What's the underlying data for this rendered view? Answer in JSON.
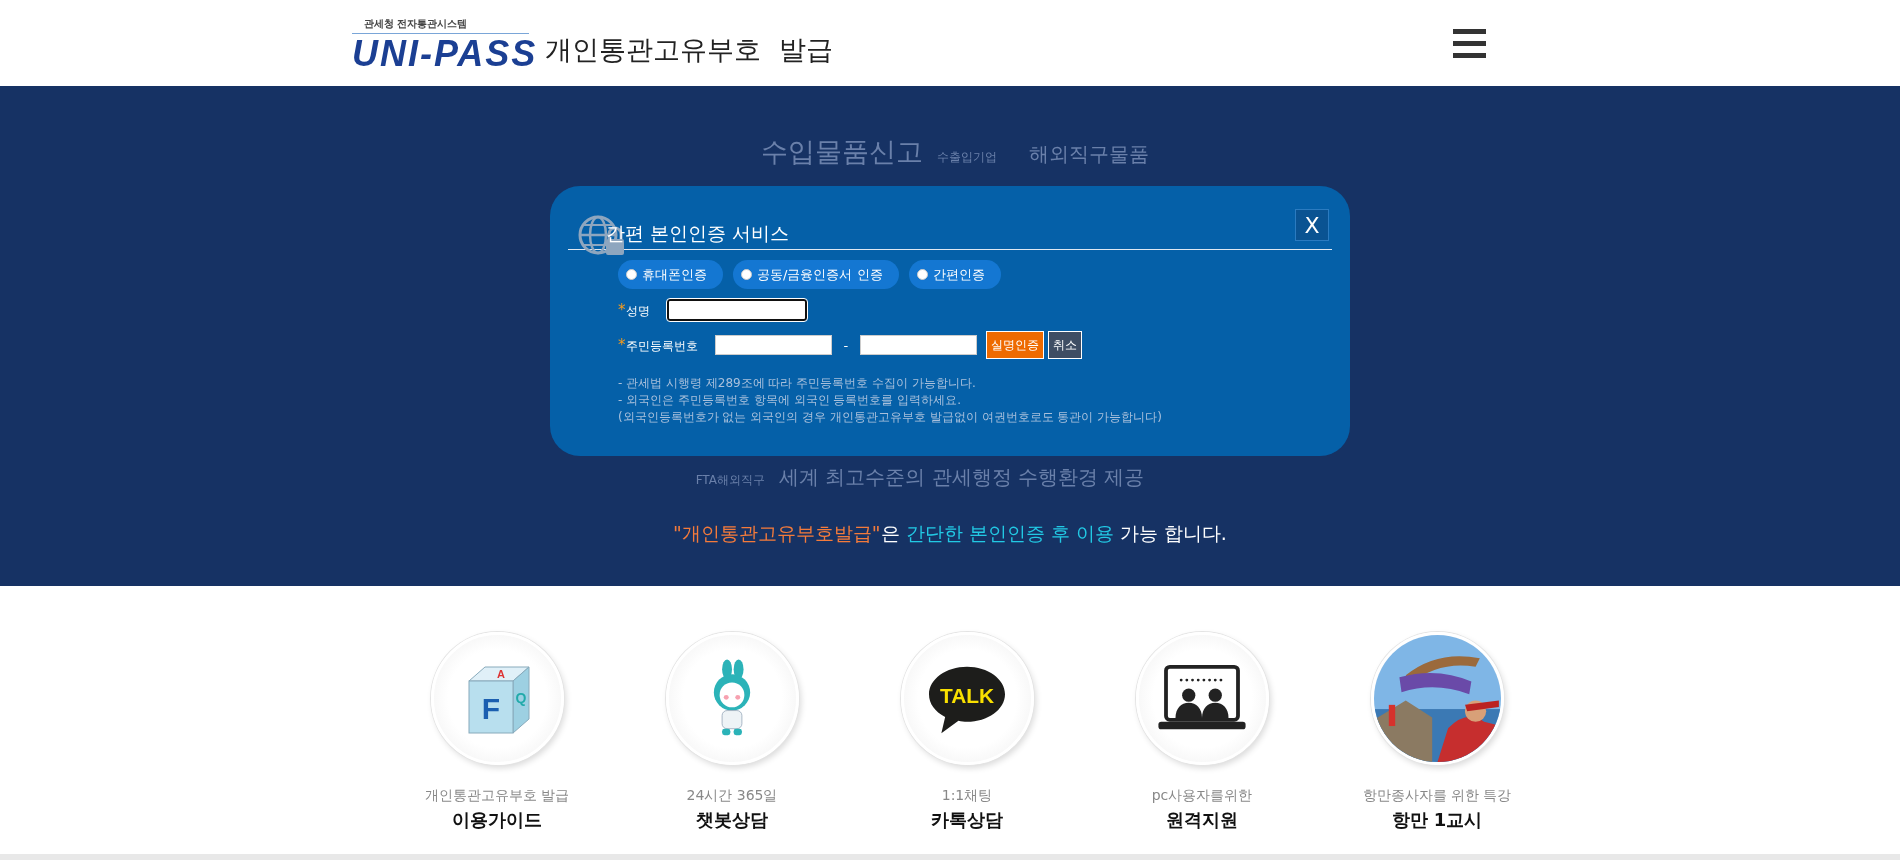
{
  "header": {
    "logo": {
      "caption": "관세청  전자통관시스템",
      "wordmark": "UNI-PASS"
    },
    "title": "개인통관고유부호  발급"
  },
  "background_words": {
    "row_1": [
      {
        "text": "수입물품신고",
        "prominent": true
      },
      {
        "text": "수출입기업",
        "prominent": false
      },
      {
        "text": "해외직구물품",
        "prominent": true
      }
    ],
    "row_2": [
      {
        "text": "FTA해외직구",
        "prominent": false
      },
      {
        "text": "세계 최고수준의 관세행정 수행환경 제공",
        "prominent": true
      }
    ]
  },
  "dialog": {
    "title": "간편 본인인증 서비스",
    "close": "X",
    "methods": [
      {
        "label": "휴대폰인증",
        "selected": false
      },
      {
        "label": "공동/금융인증서 인증",
        "selected": false
      },
      {
        "label": "간편인증",
        "selected": false
      }
    ],
    "name_field": {
      "required_mark": "*",
      "label": "성명",
      "focused": true
    },
    "id_field": {
      "required_mark": "*",
      "label": "주민등록번호",
      "separator": "-"
    },
    "buttons": [
      {
        "label": "실명인증",
        "kind": "primary"
      },
      {
        "label": "취소",
        "kind": "secondary"
      }
    ],
    "notes": [
      "- 관세법 시행령 제289조에 따라 주민등록번호 수집이 가능합니다.",
      "- 외국인은 주민등록번호 항목에 외국인 등록번호를 입력하세요.",
      "(외국인등록번호가 없는 외국인의 경우 개인통관고유부호 발급없이 여권번호로도 통관이 가능합니다)"
    ]
  },
  "message": [
    {
      "text": "\"개인통관고유부호발급\"",
      "color": "#f47b3b"
    },
    {
      "text": "은 ",
      "color": "#ffffff"
    },
    {
      "text": "간단한 본인인증 후 이용",
      "color": "#22c9e4"
    },
    {
      "text": " 가능 합니다.",
      "color": "#ffffff"
    }
  ],
  "services": [
    {
      "kind": "faq",
      "icon_letters": [
        "A",
        "F",
        "Q"
      ],
      "subtitle": "개인통관고유부호 발급",
      "title": "이용가이드"
    },
    {
      "kind": "chatbot",
      "subtitle": "24시간 365일",
      "title": "챗봇상담"
    },
    {
      "kind": "talk",
      "icon_text": "TALK",
      "subtitle": "1:1채팅",
      "title": "카톡상담"
    },
    {
      "kind": "remote",
      "subtitle": "pc사용자를위한",
      "title": "원격지원"
    },
    {
      "kind": "picture",
      "subtitle": "항만종사자를 위한 특강",
      "title": "항만 1교시"
    }
  ]
}
